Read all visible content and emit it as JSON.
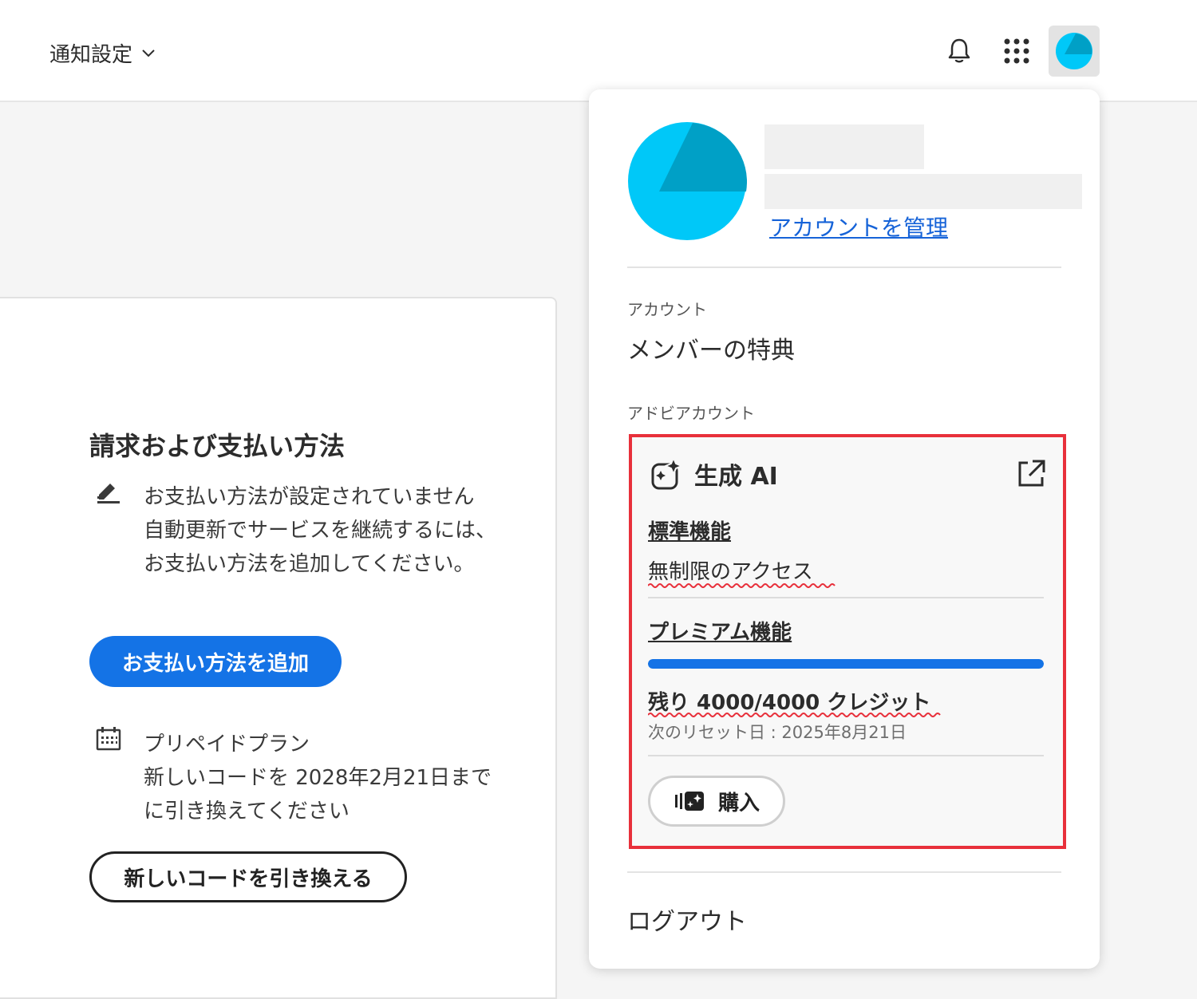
{
  "header": {
    "notification_settings_label": "通知設定"
  },
  "billing": {
    "title": "請求および支払い方法",
    "payment_status": "お支払い方法が設定されていません 自動更新でサービスを継続するには、お支払い方法を追加してください。",
    "add_payment_button": "お支払い方法を追加",
    "plan_name": "プリペイドプラン",
    "plan_note": "新しいコードを 2028年2月21日までに引き換えてください",
    "redeem_button": "新しいコードを引き換える"
  },
  "account_menu": {
    "manage_account_link": "アカウントを管理",
    "section_account_label": "アカウント",
    "member_benefits_link": "メンバーの特典",
    "section_adobe_account_label": "アドビアカウント",
    "logout_link": "ログアウト",
    "genai": {
      "title": "生成 AI",
      "standard_features_link": "標準機能",
      "standard_access_text": "無制限のアクセス",
      "premium_features_link": "プレミアム機能",
      "credits_remaining_fraction": 1.0,
      "credits_text": "残り 4000/4000 クレジット",
      "reset_text": "次のリセット日 : 2025年8月21日",
      "buy_button": "購入"
    }
  },
  "colors": {
    "accent": "#1473e6",
    "highlight_border": "#e8303b",
    "link": "#1663d8",
    "avatar_light": "#00c8f8",
    "avatar_dark": "#00a0c6"
  },
  "icons": [
    "chevron-down-icon",
    "bell-icon",
    "apps-grid-icon",
    "avatar-icon",
    "payment-edit-icon",
    "calendar-icon",
    "genai-sparkle-icon",
    "external-link-icon",
    "credits-icon"
  ]
}
